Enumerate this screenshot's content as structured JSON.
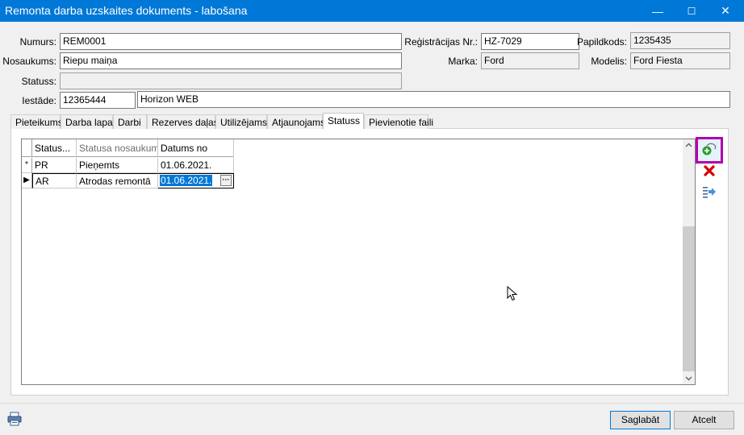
{
  "window": {
    "title": "Remonta darba uzskaites dokuments - labošana",
    "controls": {
      "minimize": "—",
      "maximize": "☐",
      "close": "✕"
    }
  },
  "form": {
    "numurs": {
      "label": "Numurs:",
      "value": "REM0001"
    },
    "nosaukums": {
      "label": "Nosaukums:",
      "value": "Riepu maiņa"
    },
    "statuss": {
      "label": "Statuss:",
      "value": ""
    },
    "iestade": {
      "label": "Iestāde:",
      "code": "12365444",
      "name": "Horizon WEB"
    },
    "registracijas_nr": {
      "label": "Reģistrācijas Nr.:",
      "value": "HZ-7029"
    },
    "papildkods": {
      "label": "Papildkods:",
      "value": "1235435"
    },
    "marka": {
      "label": "Marka:",
      "value": "Ford"
    },
    "modelis": {
      "label": "Modelis:",
      "value": "Ford Fiesta"
    }
  },
  "tabs": [
    {
      "label": "Pieteikums"
    },
    {
      "label": "Darba lapa"
    },
    {
      "label": "Darbi"
    },
    {
      "label": "Rezerves daļas"
    },
    {
      "label": "Utilizējams"
    },
    {
      "label": "Atjaunojams"
    },
    {
      "label": "Statuss",
      "active": true
    },
    {
      "label": "Pievienotie faili"
    }
  ],
  "grid": {
    "columns": [
      "Status...",
      "Statusa nosaukums",
      "Datums no"
    ],
    "rows": [
      {
        "indicator": "*",
        "code": "PR",
        "name": "Pieņemts",
        "date": "01.06.2021."
      },
      {
        "indicator": "▶",
        "code": "AR",
        "name": "Atrodas remontā",
        "date": "01.06.2021.",
        "editing": true,
        "ellipsis": "···"
      }
    ]
  },
  "side_buttons": [
    "add-icon",
    "delete-icon",
    "export-icon"
  ],
  "footer": {
    "save_label": "Saglabāt",
    "cancel_label": "Atcelt"
  },
  "colors": {
    "titlebar": "#0078d7",
    "selection": "#0078d7",
    "highlight_border": "#b000b0",
    "delete": "#d40000"
  }
}
